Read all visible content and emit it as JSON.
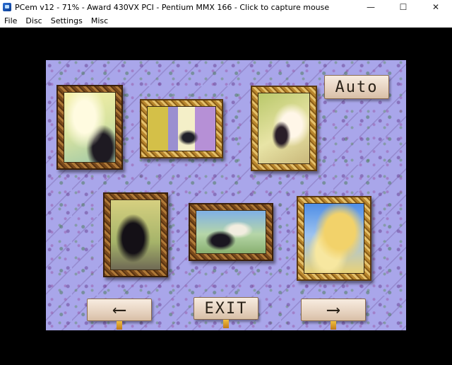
{
  "window": {
    "title": "PCem v12 - 71% - Award 430VX PCI - Pentium MMX 166 - Click to capture mouse",
    "controls": {
      "minimize": "—",
      "maximize": "☐",
      "close": "✕"
    }
  },
  "menu": [
    "File",
    "Disc",
    "Settings",
    "Misc"
  ],
  "game": {
    "auto_label": "Auto",
    "exit_label": "EXIT",
    "prev_arrow": "⟵",
    "next_arrow": "⟶",
    "paintings": [
      "painting-1",
      "painting-2",
      "painting-3",
      "painting-4",
      "painting-5",
      "painting-6"
    ]
  },
  "colors": {
    "wallpaper": "#a9a6ea",
    "frame_wood": "#7a4a1c",
    "frame_gold": "#b8862e",
    "sign": "#f0e2d4"
  }
}
